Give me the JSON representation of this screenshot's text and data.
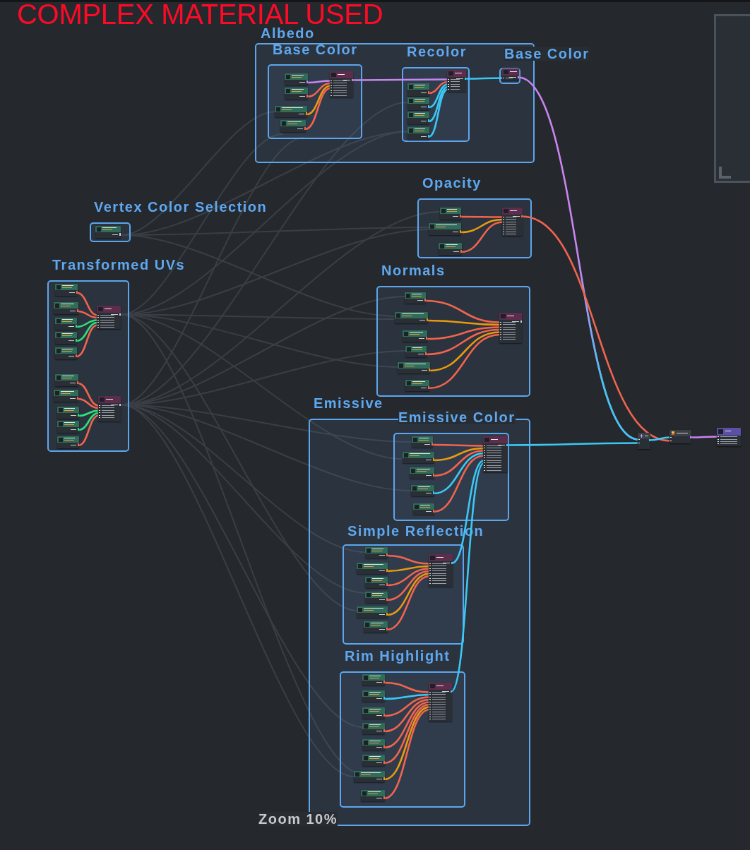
{
  "annotation": "COMPLEX MATERIAL USED",
  "groups": [
    {
      "title": "Albedo",
      "children": [
        {
          "title": "Base Color",
          "nodes": [
            {
              "kind": "parameter",
              "color": "#c985f0"
            },
            {
              "kind": "parameter",
              "color": "#f2644e"
            },
            {
              "kind": "parameter",
              "color": "#e89a10"
            },
            {
              "kind": "parameter",
              "color": "#f2644e"
            },
            {
              "kind": "function",
              "color": "#c985f0"
            }
          ]
        },
        {
          "title": "Recolor",
          "nodes": [
            {
              "kind": "parameter",
              "color": "#f2644e"
            },
            {
              "kind": "parameter",
              "color": "#3cc8f5"
            },
            {
              "kind": "parameter",
              "color": "#3cc8f5"
            },
            {
              "kind": "parameter",
              "color": "#3cc8f5"
            },
            {
              "kind": "function",
              "color": "#3cc8f5"
            }
          ]
        },
        {
          "title": "Base Color",
          "nodes": [
            {
              "kind": "function",
              "color": "#c985f0"
            }
          ]
        }
      ]
    },
    {
      "title": "Opacity",
      "nodes": [
        {
          "kind": "parameter",
          "color": "#f2644e"
        },
        {
          "kind": "parameter",
          "color": "#e89a10"
        },
        {
          "kind": "parameter",
          "color": "#f2644e"
        },
        {
          "kind": "function",
          "color": "#f2644e"
        }
      ]
    },
    {
      "title": "Vertex Color Selection",
      "nodes": [
        {
          "kind": "parameter"
        }
      ]
    },
    {
      "title": "Transformed UVs",
      "nodes": [
        {
          "kind": "parameter",
          "color": "#f2644e"
        },
        {
          "kind": "parameter",
          "color": "#f2644e"
        },
        {
          "kind": "parameter",
          "color": "#2ee07a"
        },
        {
          "kind": "parameter",
          "color": "#2ee07a"
        },
        {
          "kind": "parameter",
          "color": "#f2644e"
        },
        {
          "kind": "function"
        },
        {
          "kind": "parameter",
          "color": "#f2644e"
        },
        {
          "kind": "parameter",
          "color": "#f2644e"
        },
        {
          "kind": "parameter",
          "color": "#2ee07a"
        },
        {
          "kind": "parameter",
          "color": "#2ee07a"
        },
        {
          "kind": "parameter",
          "color": "#f2644e"
        },
        {
          "kind": "function"
        }
      ]
    },
    {
      "title": "Normals",
      "nodes": [
        {
          "kind": "parameter",
          "color": "#f2644e"
        },
        {
          "kind": "parameter",
          "color": "#e89a10"
        },
        {
          "kind": "parameter",
          "color": "#f2644e"
        },
        {
          "kind": "parameter",
          "color": "#f2644e"
        },
        {
          "kind": "parameter",
          "color": "#e89a10"
        },
        {
          "kind": "parameter",
          "color": "#f2644e"
        },
        {
          "kind": "function"
        }
      ]
    },
    {
      "title": "Emissive",
      "children": [
        {
          "title": "Emissive Color",
          "nodes": [
            {
              "kind": "parameter",
              "color": "#f2644e"
            },
            {
              "kind": "parameter",
              "color": "#e89a10"
            },
            {
              "kind": "parameter",
              "color": "#f2644e"
            },
            {
              "kind": "parameter",
              "color": "#3cc8f5"
            },
            {
              "kind": "parameter",
              "color": "#f2644e"
            },
            {
              "kind": "function",
              "color": "#3cc8f5"
            }
          ]
        },
        {
          "title": "Simple Reflection",
          "nodes": [
            {
              "kind": "parameter",
              "color": "#f2644e"
            },
            {
              "kind": "parameter",
              "color": "#e89a10"
            },
            {
              "kind": "parameter",
              "color": "#f2644e"
            },
            {
              "kind": "parameter",
              "color": "#f2644e"
            },
            {
              "kind": "parameter",
              "color": "#e89a10"
            },
            {
              "kind": "parameter",
              "color": "#f2644e"
            },
            {
              "kind": "function",
              "color": "#3cc8f5"
            }
          ]
        },
        {
          "title": "Rim Highlight",
          "nodes": [
            {
              "kind": "parameter",
              "color": "#f2644e"
            },
            {
              "kind": "parameter",
              "color": "#3cc8f5"
            },
            {
              "kind": "parameter",
              "color": "#f2644e"
            },
            {
              "kind": "parameter",
              "color": "#f2644e"
            },
            {
              "kind": "parameter",
              "color": "#f2644e"
            },
            {
              "kind": "parameter",
              "color": "#f2644e"
            },
            {
              "kind": "parameter",
              "color": "#e89a10"
            },
            {
              "kind": "parameter",
              "color": "#f2644e"
            },
            {
              "kind": "function",
              "color": "#3cc8f5"
            }
          ]
        }
      ]
    }
  ],
  "output_chain": [
    {
      "kind": "add",
      "color": "#3cc8f5"
    },
    {
      "kind": "material",
      "color": "#c985f0"
    },
    {
      "kind": "output"
    }
  ],
  "zoom_label": "Zoom 10%"
}
